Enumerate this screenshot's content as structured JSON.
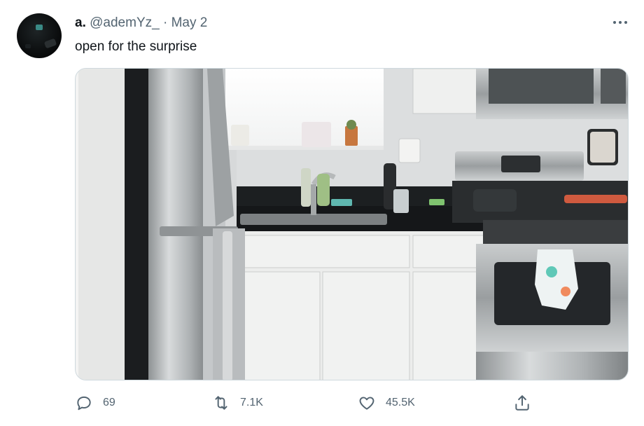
{
  "tweet": {
    "author_name": "a.",
    "handle": "@ademYz_",
    "separator": "·",
    "date": "May 2",
    "text": "open for the surprise",
    "media_alt": "kitchen photo with open refrigerator door, sink, white cabinets and stove",
    "actions": {
      "replies": "69",
      "retweets": "7.1K",
      "likes": "45.5K"
    },
    "icons": {
      "reply": "reply-icon",
      "retweet": "retweet-icon",
      "like": "heart-icon",
      "share": "share-icon",
      "more": "more-icon"
    },
    "colors": {
      "text": "#0f1419",
      "secondary": "#536471",
      "border": "#cfd9de"
    }
  }
}
